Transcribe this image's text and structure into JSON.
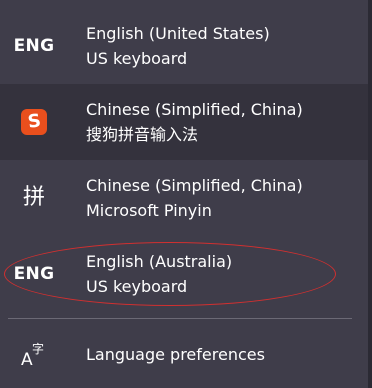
{
  "languages": [
    {
      "icon": "ENG",
      "icon_name": "eng-icon",
      "name": "English (United States)",
      "keyboard": "US keyboard"
    },
    {
      "icon": "S",
      "icon_name": "sogou-icon",
      "name": "Chinese (Simplified, China)",
      "keyboard": "搜狗拼音输入法"
    },
    {
      "icon": "拼",
      "icon_name": "pinyin-icon",
      "name": "Chinese (Simplified, China)",
      "keyboard": "Microsoft Pinyin"
    },
    {
      "icon": "ENG",
      "icon_name": "eng-icon",
      "name": "English (Australia)",
      "keyboard": "US keyboard"
    }
  ],
  "preferences": {
    "label": "Language preferences",
    "icon_name": "language-icon"
  },
  "colors": {
    "background": "#3f3d4a",
    "highlight": "#34323d",
    "sogou": "#e94f1d",
    "annotation": "#d03030"
  }
}
